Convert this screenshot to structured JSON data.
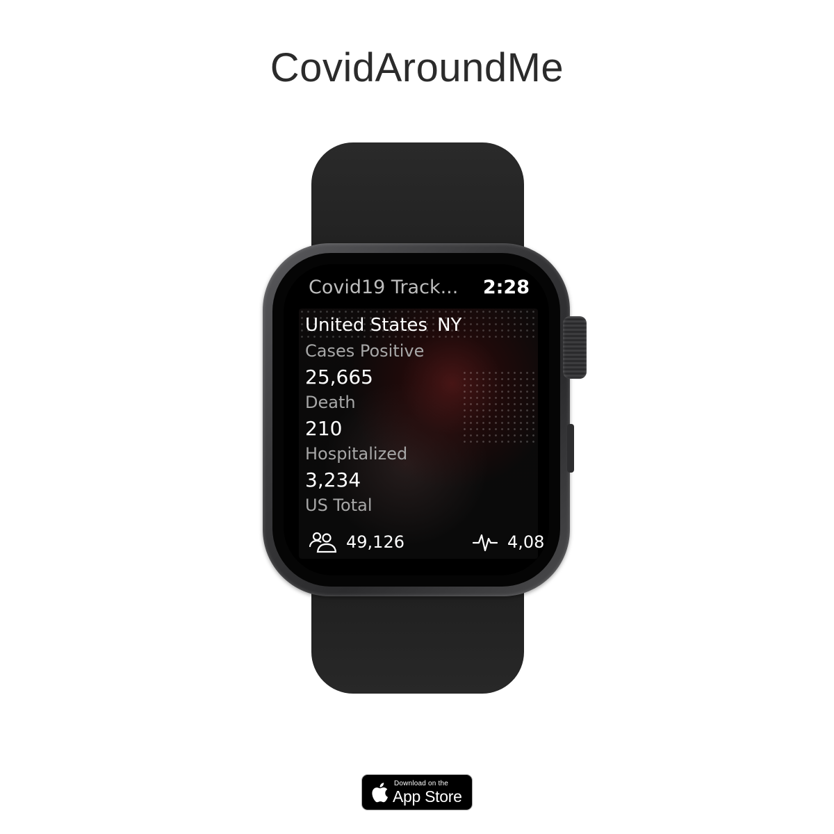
{
  "page": {
    "title": "CovidAroundMe"
  },
  "watch": {
    "app_title": "Covid19 Track...",
    "time": "2:28",
    "location": {
      "country": "United States",
      "state": "NY"
    },
    "stats": [
      {
        "label": "Cases Positive",
        "value": "25,665"
      },
      {
        "label": "Death",
        "value": "210"
      },
      {
        "label": "Hospitalized",
        "value": "3,234"
      }
    ],
    "us_total_label": "US Total",
    "us_total": {
      "cases_icon": "people-icon",
      "cases": "49,126",
      "deaths_icon": "pulse-icon",
      "deaths": "4,08"
    }
  },
  "badge": {
    "small_text": "Download on the",
    "big_text": "App Store",
    "icon": "apple-logo-icon"
  },
  "colors": {
    "background": "#ffffff",
    "title": "#2b2b2b",
    "band": "#222222",
    "screen_label": "#a7a7a7",
    "screen_value": "#ffffff"
  }
}
